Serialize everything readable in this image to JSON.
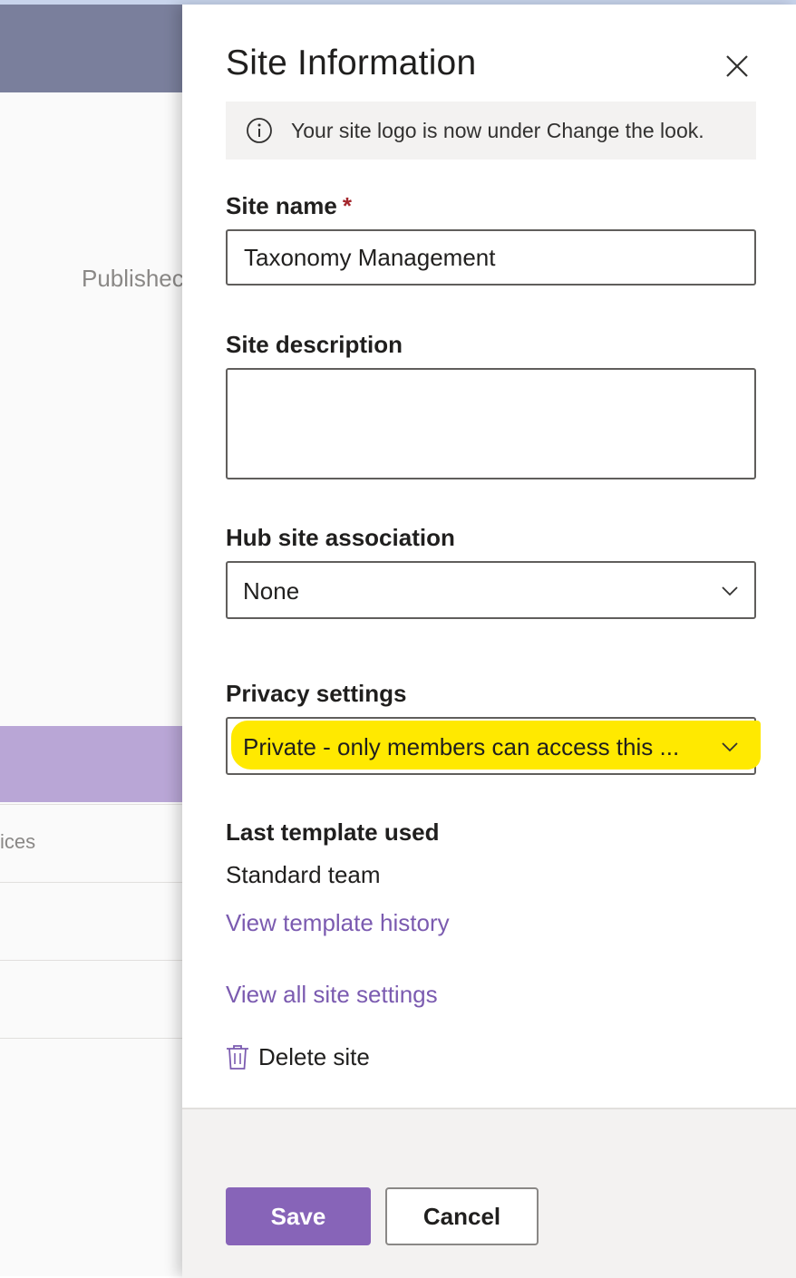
{
  "background": {
    "published_text": "Publishec",
    "row_text": "ices"
  },
  "panel": {
    "title": "Site Information",
    "close_icon": "close-icon",
    "info_bar": {
      "icon": "info-icon",
      "message": "Your site logo is now under Change the look."
    },
    "site_name": {
      "label": "Site name",
      "required_marker": "*",
      "value": "Taxonomy Management"
    },
    "site_description": {
      "label": "Site description",
      "value": ""
    },
    "hub_site_association": {
      "label": "Hub site association",
      "selected": "None"
    },
    "privacy_settings": {
      "label": "Privacy settings",
      "selected": "Private - only members can access this ...",
      "highlight_color": "#ffe900"
    },
    "last_template": {
      "label": "Last template used",
      "value": "Standard team",
      "history_link": "View template history"
    },
    "all_settings_link": "View all site settings",
    "delete": {
      "icon": "trash-icon",
      "label": "Delete site"
    },
    "footer": {
      "save_label": "Save",
      "cancel_label": "Cancel"
    }
  },
  "colors": {
    "accent": "#8764b8",
    "link": "#7b5bb0",
    "required": "#a4262c",
    "header_bg": "#7a7f9c",
    "band_bg": "#b9a6d6"
  }
}
